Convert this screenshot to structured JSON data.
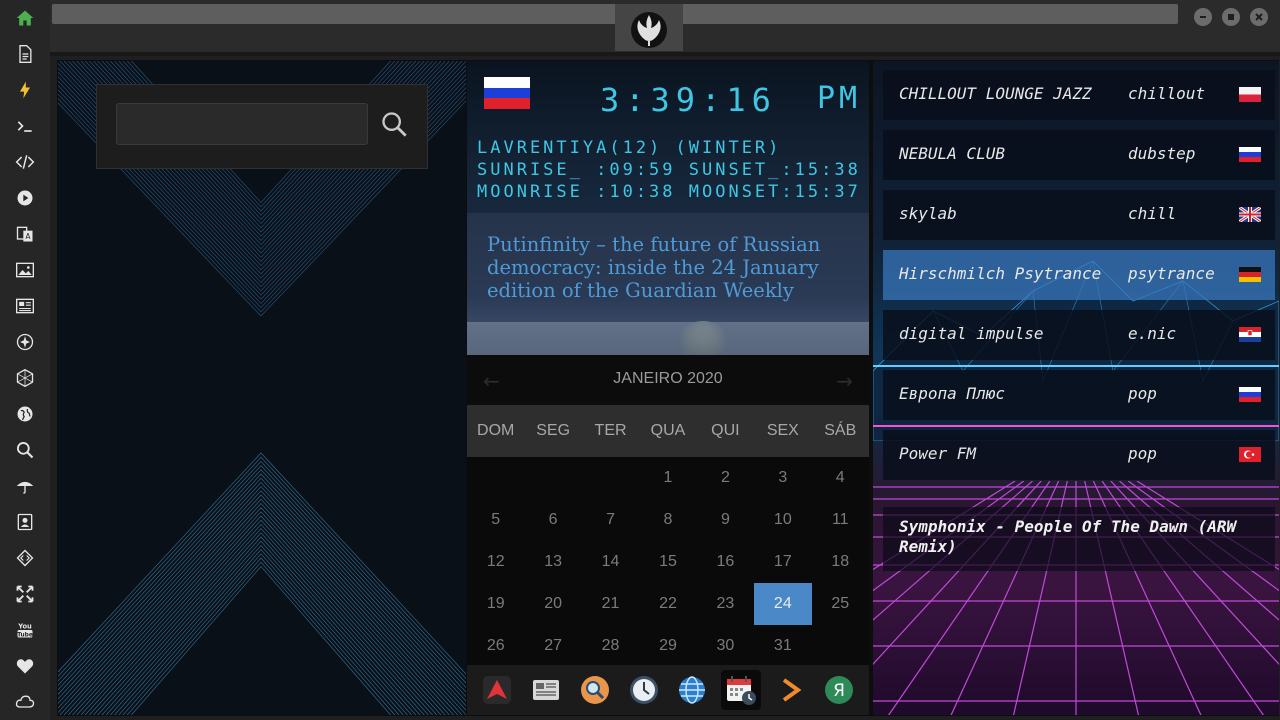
{
  "sidebar": {
    "icons": [
      "home-icon",
      "document-icon",
      "lightning-icon",
      "terminal-icon",
      "code-icon",
      "play-icon",
      "translate-icon",
      "image-icon",
      "news-icon",
      "rebel-icon",
      "hexagon-icon",
      "globe-icon",
      "search-icon",
      "umbrella-icon",
      "contact-icon",
      "diamond-code-icon",
      "expand-icon",
      "youtube-icon",
      "heart-icon",
      "cloud-icon"
    ],
    "accent": "#4caf50"
  },
  "search": {
    "value": "",
    "placeholder": ""
  },
  "clock": {
    "time": "3:39:16",
    "ampm": "PM",
    "flag": "russia-flag",
    "location": "LAVRENTIYA(12) (WINTER)",
    "sun": "SUNRISE_ :09:59 SUNSET_:15:38",
    "moon": "MOONRISE :10:38 MOONSET:15:37",
    "color": "#3ec6e4"
  },
  "news": {
    "headline": "Putinfinity – the future of Russian democracy: inside the 24 January edition of the Guardian Weekly"
  },
  "calendar": {
    "month": "JANEIRO 2020",
    "weekdays": [
      "DOM",
      "SEG",
      "TER",
      "QUA",
      "QUI",
      "SEX",
      "SÁB"
    ],
    "days": [
      "",
      "",
      "",
      "1",
      "2",
      "3",
      "4",
      "5",
      "6",
      "7",
      "8",
      "9",
      "10",
      "11",
      "12",
      "13",
      "14",
      "15",
      "16",
      "17",
      "18",
      "19",
      "20",
      "21",
      "22",
      "23",
      "24",
      "25",
      "26",
      "27",
      "28",
      "29",
      "30",
      "31",
      ""
    ],
    "selected": "24",
    "selected_color": "#4a88c7"
  },
  "dock": {
    "icons": [
      "red-arrow-app-icon",
      "newspaper-icon",
      "search-app-icon",
      "clock-app-icon",
      "globe-app-icon",
      "calendar-app-icon",
      "play-arrow-icon",
      "yandex-icon"
    ],
    "active": "calendar-app-icon"
  },
  "radio": {
    "stations": [
      {
        "name": "CHILLOUT LOUNGE JAZZ",
        "genre": "chillout",
        "flag": "poland-flag"
      },
      {
        "name": "NEBULA CLUB",
        "genre": "dubstep",
        "flag": "russia-flag"
      },
      {
        "name": "skylab",
        "genre": "chill",
        "flag": "uk-flag"
      },
      {
        "name": "Hirschmilch Psytrance",
        "genre": "psytrance",
        "flag": "germany-flag"
      },
      {
        "name": "digital impulse",
        "genre": "e.nic",
        "flag": "croatia-flag"
      },
      {
        "name": "Европа Плюс",
        "genre": "pop",
        "flag": "russia-flag"
      },
      {
        "name": "Power FM",
        "genre": "pop",
        "flag": "turkey-flag"
      }
    ],
    "active_index": 3,
    "now_playing": "Symphonix - People Of The Dawn (ARW Remix)"
  }
}
